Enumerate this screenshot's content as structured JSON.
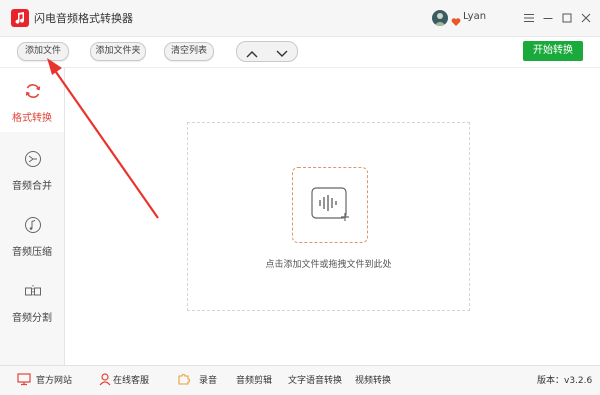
{
  "window": {
    "title": "闪电音频格式转换器",
    "username": "Lyan"
  },
  "toolbar": {
    "add_file": "添加文件",
    "add_folder": "添加文件夹",
    "clear_list": "清空列表",
    "start": "开始转换"
  },
  "sidebar": {
    "items": [
      {
        "label": "格式转换",
        "icon": "refresh-icon",
        "active": true
      },
      {
        "label": "音频合并",
        "icon": "merge-icon"
      },
      {
        "label": "音频压缩",
        "icon": "compress-icon"
      },
      {
        "label": "音频分割",
        "icon": "split-icon"
      }
    ]
  },
  "main": {
    "drop_text": "点击添加文件或拖拽文件到此处"
  },
  "statusbar": {
    "official_site": "官方网站",
    "online_support": "在线客服",
    "record": "录音",
    "audio_edit": "音频剪辑",
    "speech_to_text": "文字语音转换",
    "video_convert": "视频转换",
    "version": "版本：v3.2.6"
  },
  "colors": {
    "accent": "#e0453b",
    "start_button": "#1aaa3c",
    "annotation_arrow": "#e8342d"
  }
}
